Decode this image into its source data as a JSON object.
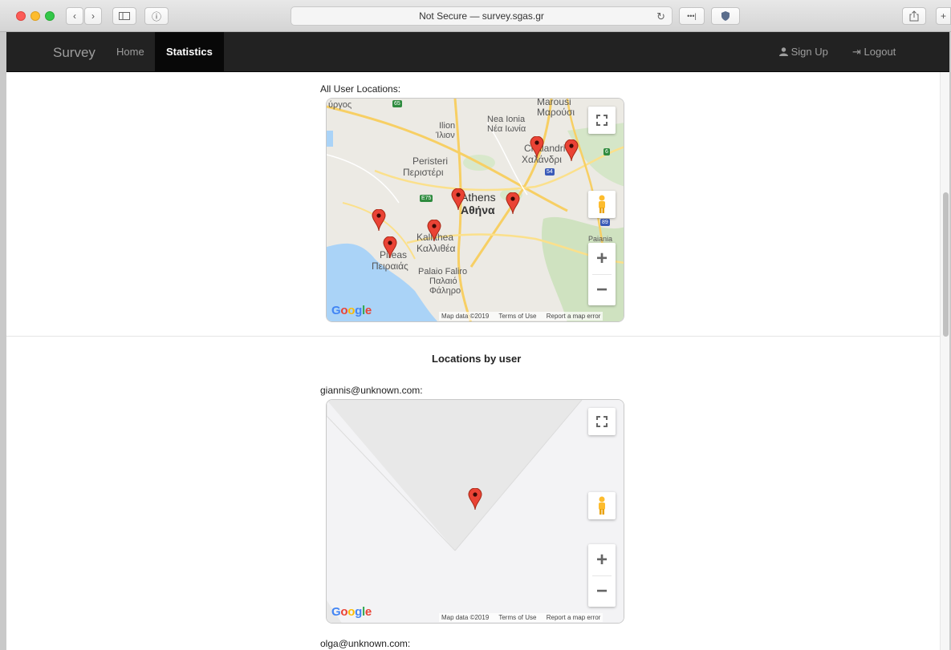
{
  "browser": {
    "address": "Not Secure — survey.sgas.gr",
    "reload_glyph": "↻",
    "back_glyph": "‹",
    "forward_glyph": "›",
    "reader_glyph": "ⓘ",
    "more_glyph": "•••|"
  },
  "navbar": {
    "brand": "Survey",
    "links": [
      "Home",
      "Statistics"
    ],
    "right": [
      "Sign Up",
      "Logout"
    ],
    "user_glyph": "👤",
    "logout_glyph": "⇥"
  },
  "section1": {
    "label": "All User Locations:"
  },
  "section2": {
    "title": "Locations by user",
    "user1": "giannis@unknown.com:",
    "user2": "olga@unknown.com:"
  },
  "map1": {
    "places": {
      "marousi": "Marousi",
      "marousi_gr": "Μαρούσι",
      "nea_ionia": "Nea Ionia",
      "nea_ionia_gr": "Νέα Ιωνία",
      "ilion": "Ilion",
      "ilion_gr": "Ίλιον",
      "peristeri": "Peristeri",
      "peristeri_gr": "Περιστέρι",
      "chalandri": "Chalandri",
      "chalandri_gr": "Χαλάνδρι",
      "athens": "Athens",
      "athens_gr": "Αθήνα",
      "kallithea": "Kallithea",
      "kallithea_gr": "Καλλιθέα",
      "pireas": "Pireas",
      "pireas_gr": "Πειραιάς",
      "palaio": "Palaio Faliro",
      "palaio_gr1": "Παλαιό",
      "palaio_gr2": "Φάληρο",
      "paiania": "Paiania",
      "argyros": "ύργος"
    },
    "shields": [
      "65",
      "6",
      "54",
      "E75",
      "89"
    ]
  },
  "map_footer": {
    "data": "Map data ©2019",
    "terms": "Terms of Use",
    "report": "Report a map error"
  },
  "google_logo": {
    "letters": [
      "G",
      "o",
      "o",
      "g",
      "l",
      "e"
    ]
  },
  "map_controls": {
    "zoom_in": "+",
    "zoom_out": "−"
  },
  "colors": {
    "navbar": "#222222",
    "pin": "#ea4335",
    "water": "#aad3f7",
    "land": "#eaeaea"
  }
}
